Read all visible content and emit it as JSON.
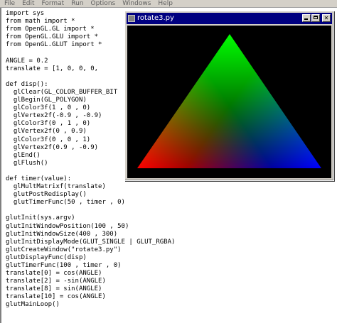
{
  "editor": {
    "menu": [
      "File",
      "Edit",
      "Format",
      "Run",
      "Options",
      "Windows",
      "Help"
    ],
    "lines": [
      "import sys",
      "from math import *",
      "from OpenGL.GL import *",
      "from OpenGL.GLU import *",
      "from OpenGL.GLUT import *",
      "",
      "ANGLE = 0.2",
      "translate = [1, 0, 0, 0,",
      "",
      "def disp():",
      "  glClear(GL_COLOR_BUFFER_BIT",
      "  glBegin(GL_POLYGON)",
      "  glColor3f(1 , 0 , 0)",
      "  glVertex2f(-0.9 , -0.9)",
      "  glColor3f(0 , 1 , 0)",
      "  glVertex2f(0 , 0.9)",
      "  glColor3f(0 , 0 , 1)",
      "  glVertex2f(0.9 , -0.9)",
      "  glEnd()",
      "  glFlush()",
      "",
      "def timer(value):",
      "  glMultMatrixf(translate)",
      "  glutPostRedisplay()",
      "  glutTimerFunc(50 , timer , 0)",
      "",
      "glutInit(sys.argv)",
      "glutInitWindowPosition(100 , 50)",
      "glutInitWindowSize(400 , 300)",
      "glutInitDisplayMode(GLUT_SINGLE | GLUT_RGBA)",
      "glutCreateWindow(\"rotate3.py\")",
      "glutDisplayFunc(disp)",
      "glutTimerFunc(100 , timer , 0)",
      "translate[0] = cos(ANGLE)",
      "translate[2] = -sin(ANGLE)",
      "translate[8] = sin(ANGLE)",
      "translate[10] = cos(ANGLE)",
      "glutMainLoop()"
    ]
  },
  "gl_window": {
    "title": "rotate3.py",
    "background_color": "#000000",
    "titlebar_color": "#000080",
    "vertex_colors": [
      "#ff0000",
      "#00ff00",
      "#0000ff"
    ]
  }
}
